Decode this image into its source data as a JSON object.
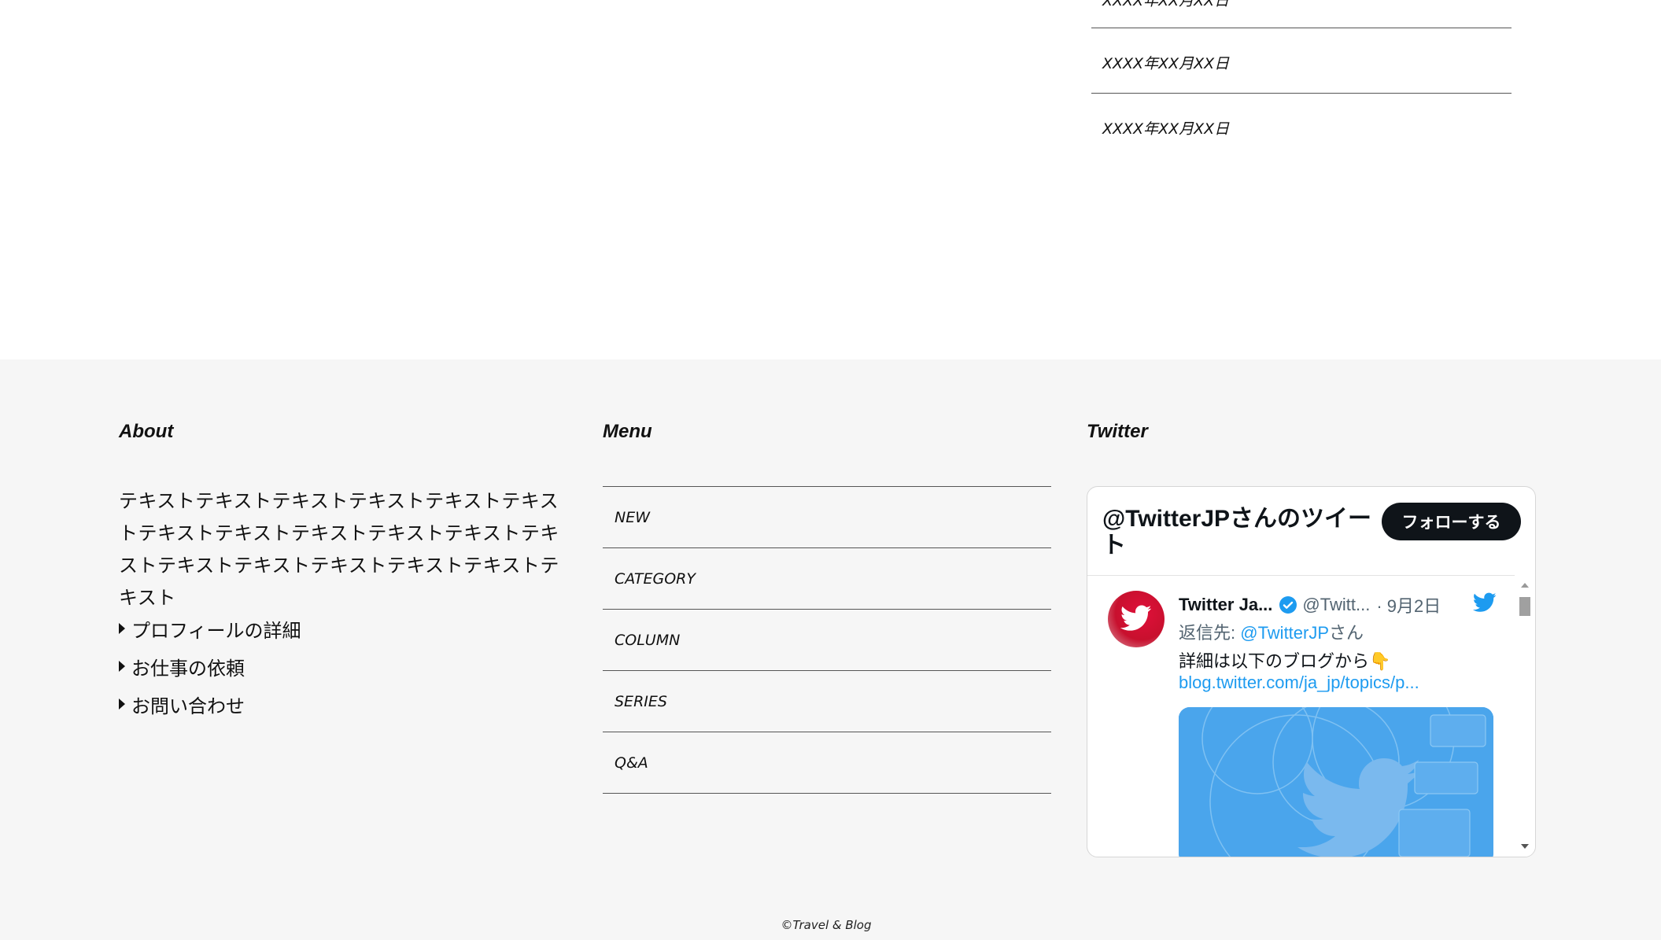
{
  "top_list": {
    "dates": [
      "XXXX年XX月XX日",
      "XXXX年XX月XX日",
      "XXXX年XX月XX日"
    ]
  },
  "footer": {
    "about": {
      "title": "About",
      "text": "テキストテキストテキストテキストテキストテキストテキストテキストテキストテキストテキストテキストテキストテキストテキストテキストテキストテキスト",
      "links": [
        "プロフィールの詳細",
        "お仕事の依頼",
        "お問い合わせ"
      ]
    },
    "menu": {
      "title": "Menu",
      "items": [
        "NEW",
        "CATEGORY",
        "COLUMN",
        "SERIES",
        "Q&A"
      ]
    },
    "twitter": {
      "title": "Twitter",
      "widget_title": "@TwitterJPさんのツイート",
      "follow_label": "フォローする",
      "tweet": {
        "name": "Twitter Ja...",
        "handle": "@Twitt...",
        "date": "· 9月2日",
        "reply_prefix": "返信先: ",
        "reply_to": "@TwitterJP",
        "reply_suffix": "さん",
        "text": "詳細は以下のブログから👇",
        "link": "blog.twitter.com/ja_jp/topics/p..."
      }
    },
    "copyright": "©Travel & Blog"
  }
}
